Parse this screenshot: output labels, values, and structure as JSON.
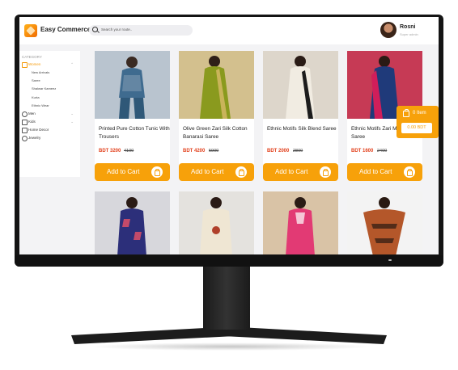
{
  "header": {
    "brand": "Easy Commerce",
    "search_placeholder": "Search your route..",
    "user_name": "Rosni",
    "user_subtitle": "Super admin"
  },
  "sidebar": {
    "title": "CATEGORY",
    "items": [
      {
        "label": "Women",
        "active": true,
        "icon": "dress-icon"
      },
      {
        "label": "New Arrivals",
        "sub": true
      },
      {
        "label": "Saree",
        "sub": true
      },
      {
        "label": "Shalwar Kameez",
        "sub": true
      },
      {
        "label": "Kurta",
        "sub": true
      },
      {
        "label": "Ethnic Wear",
        "sub": true
      },
      {
        "label": "Men",
        "icon": "person-icon"
      },
      {
        "label": "Kids",
        "icon": "kids-icon"
      },
      {
        "label": "Home Decor",
        "icon": "sofa-icon"
      },
      {
        "label": "Jewelry",
        "icon": "ring-icon"
      }
    ]
  },
  "products": [
    {
      "title": "Printed Pure Cotton Tunic With Trousers",
      "price": "BDT 3200",
      "old_price": "4100",
      "cta": "Add to Cart",
      "colors": [
        "#3f6b8f",
        "#a9b9c8"
      ]
    },
    {
      "title": "Olive Green Zari Silk Cotton Banarasi Saree",
      "price": "BDT 4200",
      "old_price": "5900",
      "cta": "Add to Cart",
      "colors": [
        "#8a9a1e",
        "#c9b45a"
      ]
    },
    {
      "title": "Ethnic Motifs Silk Blend Saree",
      "price": "BDT 2000",
      "old_price": "2800",
      "cta": "Add to Cart",
      "colors": [
        "#f1ece2",
        "#1c1c1c"
      ]
    },
    {
      "title": "Ethnic Motifs Zari Mysore Silk Saree",
      "price": "BDT 1600",
      "old_price": "2400",
      "cta": "Add to Cart",
      "colors": [
        "#1f3a7a",
        "#d01e5a"
      ]
    }
  ],
  "products_row2": [
    {
      "colors": [
        "#2c2f7a",
        "#c24a6a"
      ]
    },
    {
      "colors": [
        "#efe6d3",
        "#b0402a"
      ]
    },
    {
      "colors": [
        "#e23a74",
        "#f5c6d6"
      ]
    },
    {
      "colors": [
        "#b4572a",
        "#2a1a12"
      ]
    }
  ],
  "floating_cart": {
    "count": "0 Item",
    "total": "0.00 BDT"
  },
  "colors": {
    "accent": "#f7a10a",
    "price": "#e2401c"
  }
}
